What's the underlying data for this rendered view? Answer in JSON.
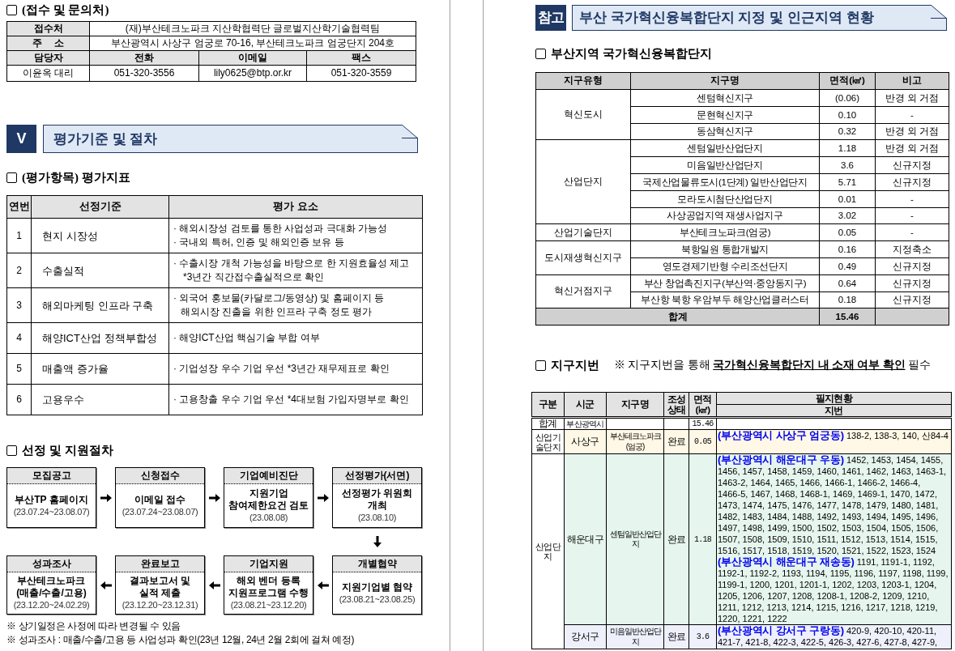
{
  "left_page": {
    "contact": {
      "heading": "(접수 및 문의처)",
      "rows": [
        {
          "label": "접수처",
          "value": "(재)부산테크노파크 지산학협력단 글로벌지산학기술협력팀"
        },
        {
          "label": "주 소",
          "value": "부산광역시 사상구 엄궁로 70-16, 부산테크노파크 엄궁단지 204호"
        }
      ],
      "columns": [
        "담당자",
        "전화",
        "이메일",
        "팩스"
      ],
      "values": [
        "이윤옥 대리",
        "051-320-3556",
        "lily0625@btp.or.kr",
        "051-320-3559"
      ]
    },
    "section": {
      "number": "V",
      "title": "평가기준 및 절차"
    },
    "criteria": {
      "heading": "(평가항목) 평가지표",
      "columns": [
        "연번",
        "선정기준",
        "평가 요소"
      ],
      "rows": [
        {
          "no": "1",
          "criterion": "현지 시장성",
          "lines": [
            {
              "kind": "bullet",
              "text": "· 해외시장성 검토를 통한 사업성과 극대화 가능성"
            },
            {
              "kind": "bullet",
              "text": "· 국내외 특허, 인증 및 해외인증 보유 등"
            }
          ]
        },
        {
          "no": "2",
          "criterion": "수출실적",
          "lines": [
            {
              "kind": "bullet",
              "text": "· 수출시장 개척 가능성을 바탕으로 한 지원효율성 제고"
            },
            {
              "kind": "note",
              "text": "*3년간 직간접수출실적으로 확인"
            }
          ]
        },
        {
          "no": "3",
          "criterion": "해외마케팅 인프라 구축",
          "lines": [
            {
              "kind": "bullet",
              "text": "· 외국어 홍보물(카달로그/동영상) 및 홈페이지 등 해외시장 진출을 위한 인프라 구축 정도 평가"
            }
          ]
        },
        {
          "no": "4",
          "criterion": "해양ICT산업 정책부합성",
          "lines": [
            {
              "kind": "bullet",
              "text": "· 해양ICT산업 핵심기술 부합 여부"
            }
          ]
        },
        {
          "no": "5",
          "criterion": "매출액 증가율",
          "lines": [
            {
              "kind": "bullet",
              "text": "· 기업성장 우수 기업 우선 *3년간 재무제표로 확인"
            }
          ]
        },
        {
          "no": "6",
          "criterion": "고용우수",
          "lines": [
            {
              "kind": "bullet",
              "text": "· 고용창출 우수 기업 우선 *4대보험 가입자명부로 확인"
            }
          ]
        }
      ]
    },
    "procedure": {
      "heading": "선정 및 지원절차",
      "steps": [
        {
          "title": "모집공고",
          "lines": [
            "부산TP 홈페이지"
          ],
          "date": "(23.07.24~23.08.07)"
        },
        {
          "title": "신청접수",
          "lines": [
            "이메일 접수"
          ],
          "date": "(23.07.24~23.08.07)"
        },
        {
          "title": "기업예비진단",
          "lines": [
            "지원기업",
            "참여제한요건 검토"
          ],
          "date": "(23.08.08)"
        },
        {
          "title": "선정평가(서면)",
          "lines": [
            "선정평가 위원회",
            "개최"
          ],
          "date": "(23.08.10)"
        },
        {
          "title": "성과조사",
          "lines": [
            "부산테크노파크",
            "(매출/수출/고용)"
          ],
          "date": "(23.12.20~24.02.29)"
        },
        {
          "title": "완료보고",
          "lines": [
            "결과보고서 및",
            "실적 제출"
          ],
          "date": "(23.12.20~23.12.31)"
        },
        {
          "title": "기업지원",
          "lines": [
            "해외 벤더 등록",
            "지원프로그램 수행"
          ],
          "date": "(23.08.21~23.12.20)"
        },
        {
          "title": "개별협약",
          "lines": [
            "지원기업별 협약"
          ],
          "date": "(23.08.21~23.08.25)"
        }
      ]
    },
    "footnotes": [
      "※ 상기일정은 사정에 따라 변경될 수 있음",
      "※ 성과조사 : 매출/수출/고용 등 사업성과 확인(23년 12월, 24년 2월 2회에 걸쳐 예정)"
    ]
  },
  "right_page": {
    "reference": {
      "badge": "참고",
      "title": "부산 국가혁신융복합단지 지정 및 인근지역 현황"
    },
    "complexes": {
      "heading": "부산지역 국가혁신융복합단지",
      "columns": [
        "지구유형",
        "지구명",
        "면적(㎢)",
        "비고"
      ],
      "groups": [
        {
          "type": "혁신도시",
          "districts": [
            {
              "name": "센텀혁신지구",
              "area": "(0.06)",
              "note": "반경 외 거점"
            },
            {
              "name": "문현혁신지구",
              "area": "0.10",
              "note": "-"
            },
            {
              "name": "동삼혁신지구",
              "area": "0.32",
              "note": "반경 외 거점"
            }
          ]
        },
        {
          "type": "산업단지",
          "districts": [
            {
              "name": "센텀일반산업단지",
              "area": "1.18",
              "note": "반경 외 거점"
            },
            {
              "name": "미음일반산업단지",
              "area": "3.6",
              "note": "신규지정"
            },
            {
              "name": "국제산업물류도시(1단계) 일반산업단지",
              "area": "5.71",
              "note": "신규지정"
            },
            {
              "name": "모라도시첨단산업단지",
              "area": "0.01",
              "note": "-"
            },
            {
              "name": "사상공업지역 재생사업지구",
              "area": "3.02",
              "note": "-"
            }
          ]
        },
        {
          "type": "산업기술단지",
          "districts": [
            {
              "name": "부산테크노파크(엄궁)",
              "area": "0.05",
              "note": "-"
            }
          ]
        },
        {
          "type": "도시재생혁신지구",
          "districts": [
            {
              "name": "북항일원 통합개발지",
              "area": "0.16",
              "note": "지정축소"
            },
            {
              "name": "영도경제기반형 수리조선단지",
              "area": "0.49",
              "note": "신규지정"
            }
          ]
        },
        {
          "type": "혁신거점지구",
          "districts": [
            {
              "name": "부산 창업촉진지구(부산역·중앙동지구)",
              "area": "0.64",
              "note": "신규지정"
            },
            {
              "name": "부산항 북항 우암부두 해양산업클러스터",
              "area": "0.18",
              "note": "신규지정"
            }
          ]
        }
      ],
      "total": {
        "label": "합계",
        "area": "15.46"
      }
    },
    "parcels": {
      "heading": "지구지번",
      "note": "※ 지구지번을 통해 **국가혁신융복합단지 내 소재 여부 확인** 필수",
      "columns": [
        "구분",
        "시군",
        "지구명",
        "조성상태",
        "면적(㎢)"
      ],
      "parcel_header": "필지현황",
      "parcel_subheader": "지번",
      "total": {
        "category": "합계",
        "city": "부산광역시",
        "area": "15.46"
      },
      "groups": [
        {
          "category": "산업기술단지",
          "rows": [
            {
              "city": "사상구",
              "name": "부산테크노파크(엄궁)",
              "status": "완료",
              "area": "0.05",
              "color": "#fff8e6",
              "parcels": [
                {
                  "dong": "(부산광역시 사상구 엄궁동)",
                  "lots": "138-2, 138-3, 140, 산84-4"
                }
              ]
            }
          ]
        },
        {
          "category": "산업단지",
          "rows": [
            {
              "city": "해운대구",
              "name": "센텀일반산업단지",
              "status": "완료",
              "area": "1.18",
              "color": "#e6f6ee",
              "parcels": [
                {
                  "dong": "(부산광역시 해운대구 우동)",
                  "lots": "1452, 1453, 1454, 1455, 1456, 1457, 1458, 1459, 1460, 1461, 1462, 1463, 1463-1, 1463-2, 1464, 1465, 1466, 1466-1, 1466-2, 1466-4, 1466-5, 1467, 1468, 1468-1, 1469, 1469-1, 1470, 1472, 1473, 1474, 1475, 1476, 1477, 1478, 1479, 1480, 1481, 1482, 1483, 1484, 1488, 1492, 1493, 1494, 1495, 1496, 1497, 1498, 1499, 1500, 1502, 1503, 1504, 1505, 1506, 1507, 1508, 1509, 1510, 1511, 1512, 1513, 1514, 1515, 1516, 1517, 1518, 1519, 1520, 1521, 1522, 1523, 1524"
                },
                {
                  "dong": "(부산광역시 해운대구 재송동)",
                  "lots": "1191, 1191-1, 1192, 1192-1, 1192-2, 1193, 1194, 1195, 1196, 1197, 1198, 1199, 1199-1, 1200, 1201, 1201-1, 1202, 1203, 1203-1, 1204, 1205, 1206, 1207, 1208, 1208-1, 1208-2, 1209, 1210, 1211, 1212, 1213, 1214, 1215, 1216, 1217, 1218, 1219, 1220, 1221, 1222"
                }
              ]
            },
            {
              "city": "강서구",
              "name": "미음일반산업단지",
              "status": "완료",
              "area": "3.6",
              "color": "#eef0fb",
              "parcels": [
                {
                  "dong": "(부산광역시 강서구 구랑동)",
                  "lots": "420-9, 420-10, 420-11, 421-7, 421-8, 422-3, 422-5, 426-3, 427-6, 427-8, 427-9,"
                }
              ]
            }
          ]
        }
      ]
    }
  }
}
